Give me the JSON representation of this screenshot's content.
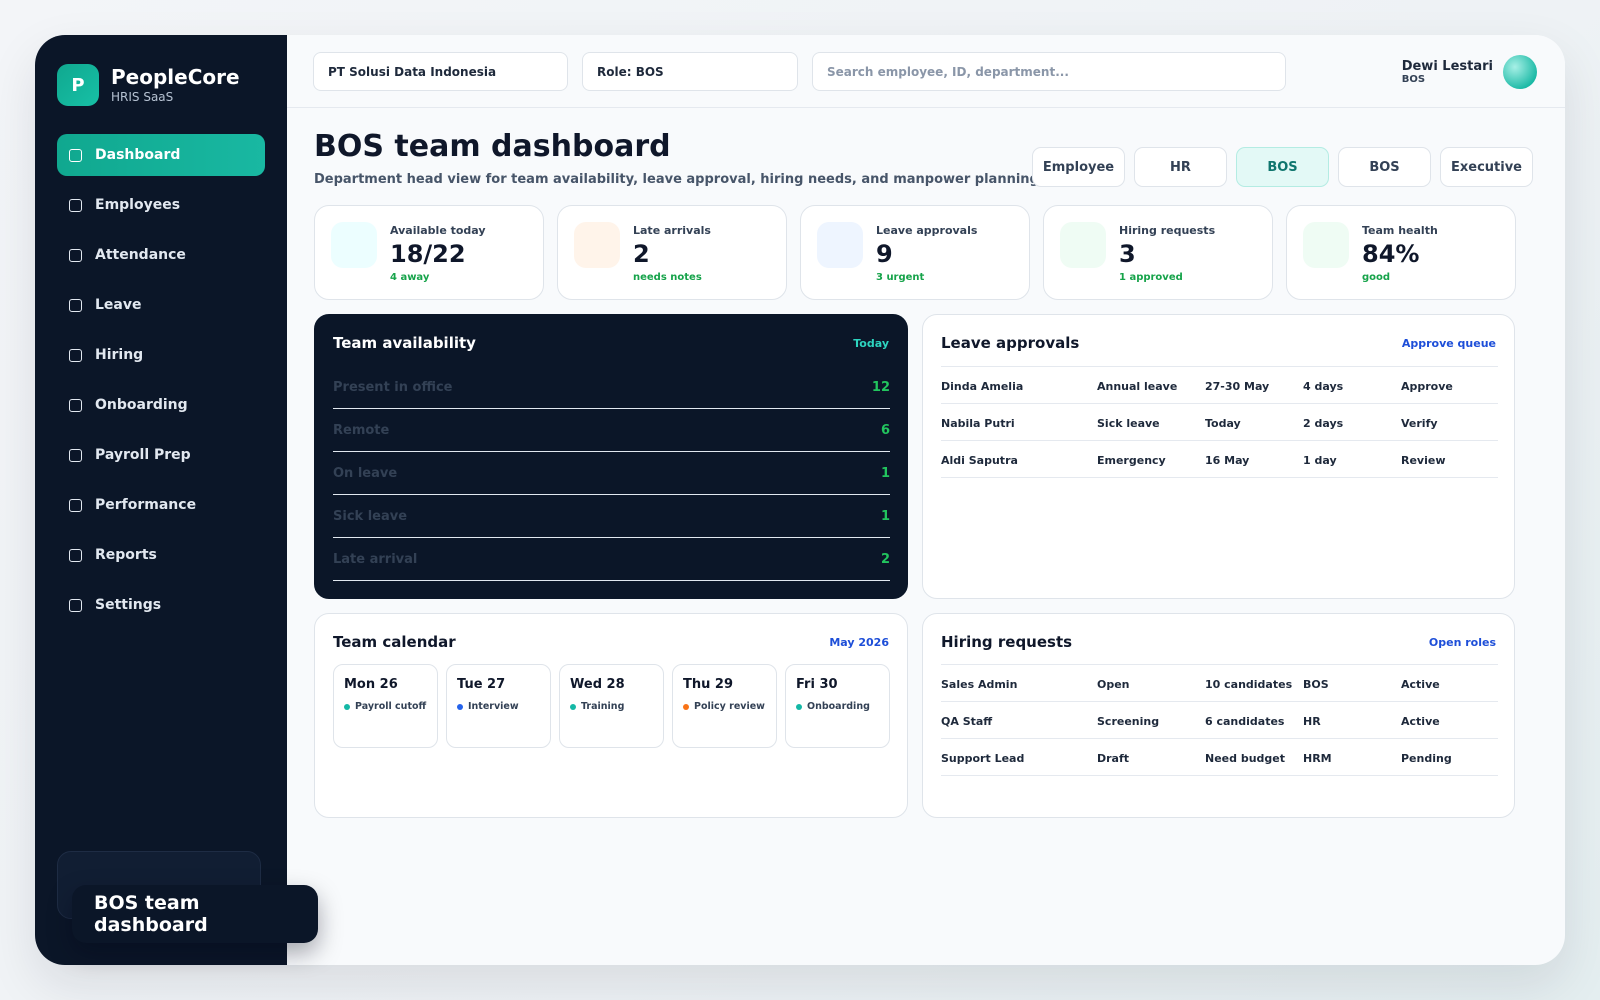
{
  "brand": {
    "logo_letter": "P",
    "name": "PeopleCore",
    "subtitle": "HRIS SaaS"
  },
  "nav": [
    {
      "label": "Dashboard",
      "active": true
    },
    {
      "label": "Employees"
    },
    {
      "label": "Attendance"
    },
    {
      "label": "Leave"
    },
    {
      "label": "Hiring"
    },
    {
      "label": "Onboarding"
    },
    {
      "label": "Payroll Prep"
    },
    {
      "label": "Performance"
    },
    {
      "label": "Reports"
    },
    {
      "label": "Settings"
    }
  ],
  "topbar": {
    "company": "PT Solusi Data Indonesia",
    "role": "Role: BOS",
    "search_placeholder": "Search employee, ID, department...",
    "user_name": "Dewi Lestari",
    "user_role": "BOS"
  },
  "page": {
    "title": "BOS team dashboard",
    "subtitle": "Department head view for team availability, leave approval, hiring needs, and manpower planning."
  },
  "role_tabs": [
    {
      "label": "Employee"
    },
    {
      "label": "HR"
    },
    {
      "label": "BOS",
      "active": true
    },
    {
      "label": "BOS"
    },
    {
      "label": "Executive"
    }
  ],
  "stats": [
    {
      "label": "Available today",
      "value": "18/22",
      "note": "4 away",
      "icon_color": "#ecfeff"
    },
    {
      "label": "Late arrivals",
      "value": "2",
      "note": "needs notes",
      "icon_color": "#fff4ea"
    },
    {
      "label": "Leave approvals",
      "value": "9",
      "note": "3 urgent",
      "icon_color": "#eef5ff"
    },
    {
      "label": "Hiring requests",
      "value": "3",
      "note": "1 approved",
      "icon_color": "#effcf4"
    },
    {
      "label": "Team health",
      "value": "84%",
      "note": "good",
      "icon_color": "#effcf4"
    }
  ],
  "availability": {
    "title": "Team availability",
    "badge": "Today",
    "rows": [
      {
        "label": "Present in office",
        "value": "12"
      },
      {
        "label": "Remote",
        "value": "6"
      },
      {
        "label": "On leave",
        "value": "1"
      },
      {
        "label": "Sick leave",
        "value": "1"
      },
      {
        "label": "Late arrival",
        "value": "2"
      }
    ]
  },
  "leave": {
    "title": "Leave approvals",
    "link": "Approve queue",
    "rows": [
      [
        "Dinda Amelia",
        "Annual leave",
        "27-30 May",
        "4 days",
        "Approve"
      ],
      [
        "Nabila Putri",
        "Sick leave",
        "Today",
        "2 days",
        "Verify"
      ],
      [
        "Aldi Saputra",
        "Emergency",
        "16 May",
        "1 day",
        "Review"
      ]
    ]
  },
  "calendar": {
    "title": "Team calendar",
    "link": "May 2026",
    "days": [
      {
        "day": "Mon 26",
        "event": "Payroll cutoff",
        "color": "#14b8a6"
      },
      {
        "day": "Tue 27",
        "event": "Interview",
        "color": "#2563eb"
      },
      {
        "day": "Wed 28",
        "event": "Training",
        "color": "#14b8a6"
      },
      {
        "day": "Thu 29",
        "event": "Policy review",
        "color": "#f97316"
      },
      {
        "day": "Fri 30",
        "event": "Onboarding",
        "color": "#14b8a6"
      }
    ]
  },
  "hiring": {
    "title": "Hiring requests",
    "link": "Open roles",
    "rows": [
      [
        "Sales Admin",
        "Open",
        "10 candidates",
        "BOS",
        "Active"
      ],
      [
        "QA Staff",
        "Screening",
        "6 candidates",
        "HR",
        "Active"
      ],
      [
        "Support Lead",
        "Draft",
        "Need budget",
        "HRM",
        "Pending"
      ]
    ]
  },
  "toast": "BOS team dashboard"
}
